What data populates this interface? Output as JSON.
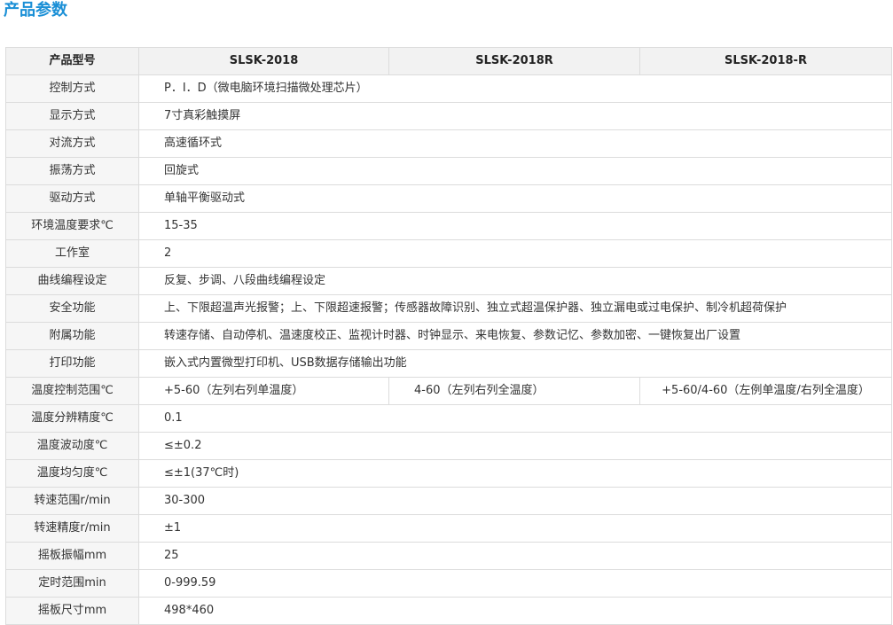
{
  "title": "产品参数",
  "header": {
    "label": "产品型号",
    "models": [
      "SLSK-2018",
      "SLSK-2018R",
      "SLSK-2018-R"
    ]
  },
  "rows": [
    {
      "label": "控制方式",
      "value": "P．I．D（微电脑环境扫描微处理芯片）"
    },
    {
      "label": "显示方式",
      "value": "7寸真彩触摸屏"
    },
    {
      "label": "对流方式",
      "value": "高速循环式"
    },
    {
      "label": "振荡方式",
      "value": "回旋式"
    },
    {
      "label": "驱动方式",
      "value": "单轴平衡驱动式"
    },
    {
      "label": "环境温度要求℃",
      "value": "15-35"
    },
    {
      "label": "工作室",
      "value": "2"
    },
    {
      "label": "曲线编程设定",
      "value": "反复、步调、八段曲线编程设定"
    },
    {
      "label": "安全功能",
      "value": "上、下限超温声光报警；上、下限超速报警；传感器故障识别、独立式超温保护器、独立漏电或过电保护、制冷机超荷保护"
    },
    {
      "label": "附属功能",
      "value": "转速存储、自动停机、温速度校正、监视计时器、时钟显示、来电恢复、参数记忆、参数加密、一键恢复出厂设置"
    },
    {
      "label": "打印功能",
      "value": "嵌入式内置微型打印机、USB数据存储输出功能"
    }
  ],
  "range_row": {
    "label": "温度控制范围℃",
    "values": [
      "+5-60（左列右列单温度）",
      "4-60（左列右列全温度）",
      "+5-60/4-60（左例单温度/右列全温度）"
    ]
  },
  "rows2": [
    {
      "label": "温度分辨精度℃",
      "value": "0.1"
    },
    {
      "label": "温度波动度℃",
      "value": "≤±0.2"
    },
    {
      "label": "温度均匀度℃",
      "value": "≤±1(37℃时)"
    },
    {
      "label": "转速范围r/min",
      "value": "30-300"
    },
    {
      "label": "转速精度r/min",
      "value": "±1"
    },
    {
      "label": "摇板振幅mm",
      "value": "25"
    },
    {
      "label": "定时范围min",
      "value": "0-999.59"
    },
    {
      "label": "摇板尺寸mm",
      "value": "498*460"
    }
  ]
}
